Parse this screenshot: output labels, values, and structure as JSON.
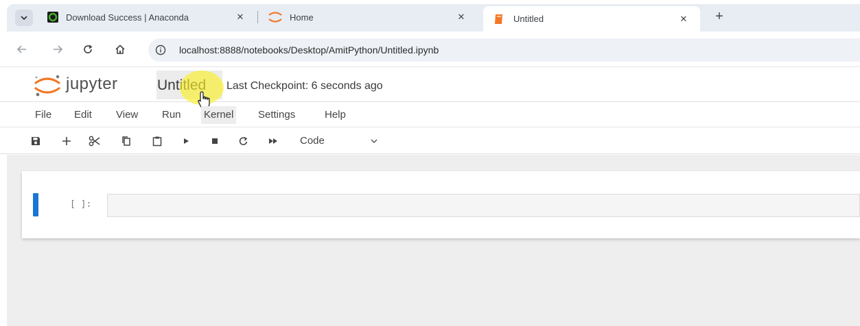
{
  "browser": {
    "tabs": [
      {
        "title": "Download Success | Anaconda",
        "active": false,
        "close": "✕"
      },
      {
        "title": "Home",
        "active": false,
        "close": "✕"
      },
      {
        "title": "Untitled",
        "active": true,
        "close": "✕"
      }
    ],
    "new_tab": "+",
    "url": "localhost:8888/notebooks/Desktop/AmitPython/Untitled.ipynb"
  },
  "jupyter": {
    "wordmark": "jupyter",
    "notebook_title": "Untitled",
    "checkpoint": "Last Checkpoint: 6 seconds ago",
    "menu": [
      "File",
      "Edit",
      "View",
      "Run",
      "Kernel",
      "Settings",
      "Help"
    ],
    "cell_type": "Code"
  },
  "cell": {
    "prompt": "[ ]:",
    "source": ""
  },
  "colors": {
    "cell_active_bar": "#1976d2",
    "jupyter_orange": "#f37726",
    "highlight": "#faf028"
  },
  "icons": {
    "toolbar": [
      "save-icon",
      "add-cell-icon",
      "cut-icon",
      "copy-icon",
      "paste-icon",
      "run-icon",
      "stop-icon",
      "restart-icon",
      "run-all-icon",
      "chevron-down-icon"
    ]
  }
}
